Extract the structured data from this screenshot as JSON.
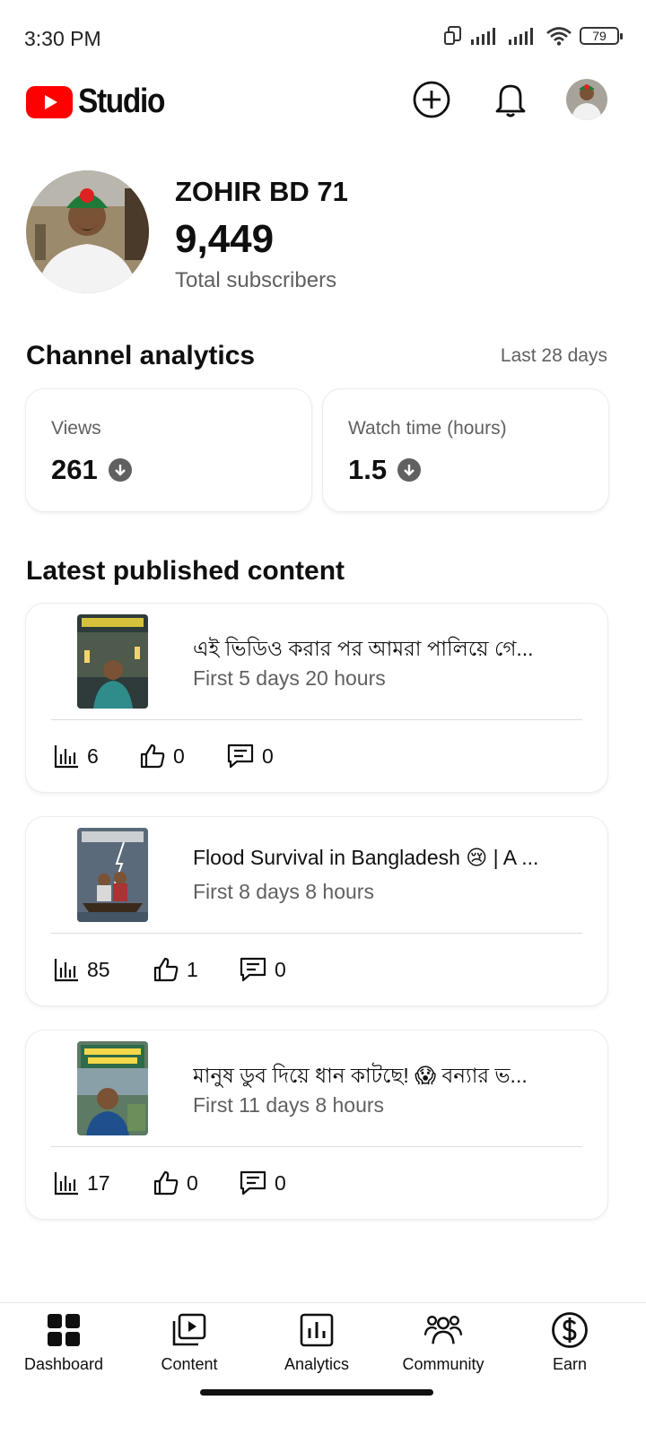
{
  "status_bar": {
    "time": "3:30 PM",
    "battery": "79"
  },
  "header": {
    "logo_text": "Studio",
    "create_icon": "add-circle-icon",
    "notifications_icon": "bell-icon"
  },
  "channel": {
    "name": "ZOHIR BD 71",
    "subscribers": "9,449",
    "subscribers_label": "Total subscribers"
  },
  "analytics": {
    "title": "Channel analytics",
    "period": "Last 28 days",
    "cards": [
      {
        "label": "Views",
        "value": "261",
        "trend": "down"
      },
      {
        "label": "Watch time (hours)",
        "value": "1.5",
        "trend": "down"
      }
    ]
  },
  "latest": {
    "title": "Latest published content",
    "items": [
      {
        "title": "এই ভিডিও করার পর আমরা পালিয়ে গে...",
        "age": "First 5 days 20 hours",
        "views": "6",
        "likes": "0",
        "comments": "0"
      },
      {
        "title": "Flood Survival in Bangladesh 😢 | A ...",
        "age": "First 8 days 8 hours",
        "views": "85",
        "likes": "1",
        "comments": "0"
      },
      {
        "title": "মানুষ ডুব দিয়ে ধান কাটছে! 😱 বন্যার ভ...",
        "age": "First 11 days 8 hours",
        "views": "17",
        "likes": "0",
        "comments": "0"
      }
    ]
  },
  "nav": {
    "items": [
      {
        "label": "Dashboard",
        "icon": "dashboard-icon"
      },
      {
        "label": "Content",
        "icon": "content-icon"
      },
      {
        "label": "Analytics",
        "icon": "analytics-icon"
      },
      {
        "label": "Community",
        "icon": "community-icon"
      },
      {
        "label": "Earn",
        "icon": "earn-icon"
      }
    ]
  },
  "colors": {
    "brand_red": "#ff0000",
    "text_primary": "#0f0f0f",
    "text_secondary": "#606060"
  }
}
